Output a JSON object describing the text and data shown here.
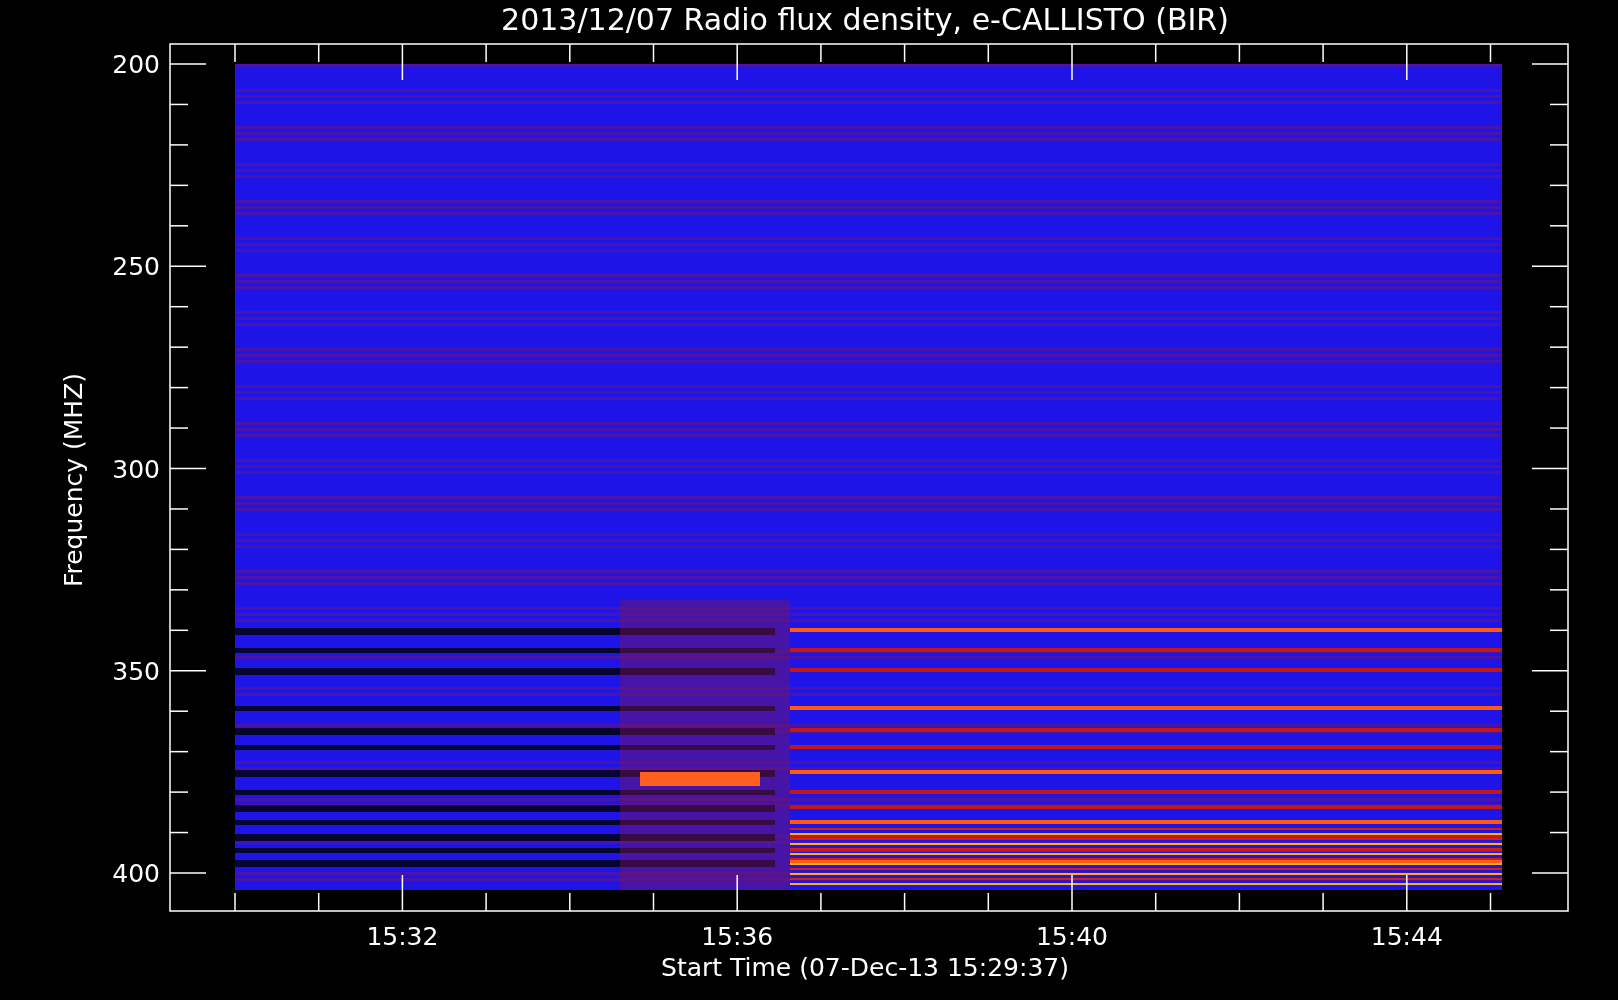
{
  "plot": {
    "title": "2013/12/07  Radio flux density, e-CALLISTO (BIR)",
    "ylabel": "Frequency (MHZ)",
    "xlabel": "Start Time (07-Dec-13 15:29:37)",
    "yticks": [
      "200",
      "250",
      "300",
      "350",
      "400"
    ],
    "xticks": [
      "15:32",
      "15:36",
      "15:40",
      "15:44"
    ]
  }
}
